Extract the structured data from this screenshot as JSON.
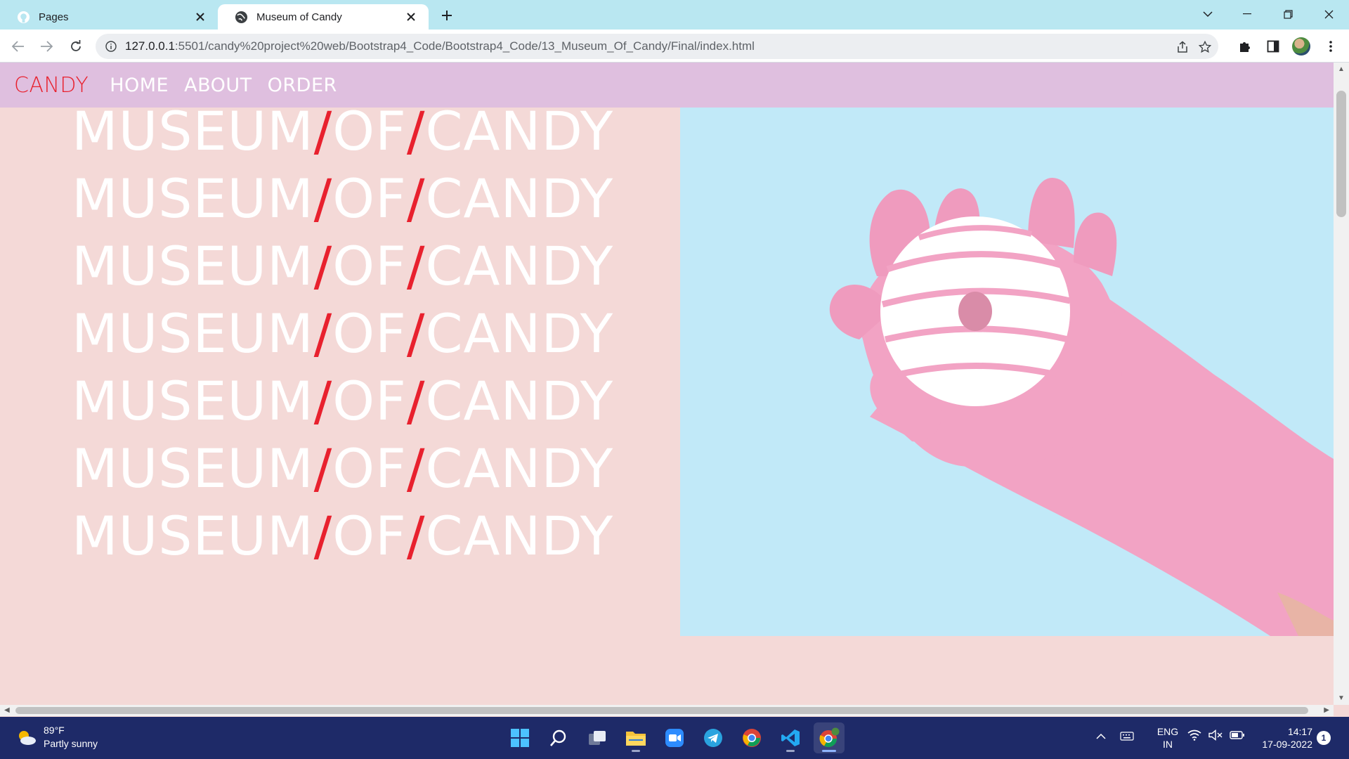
{
  "browser": {
    "tabs": [
      {
        "title": "Pages",
        "icon": "github-icon",
        "active": false
      },
      {
        "title": "Museum of Candy",
        "icon": "globe-icon",
        "active": true
      }
    ],
    "address": {
      "host": "127.0.0.1",
      "rest": ":5501/candy%20project%20web/Bootstrap4_Code/Bootstrap4_Code/13_Museum_Of_Candy/Final/index.html"
    }
  },
  "site": {
    "brand": "CANDY",
    "nav": [
      "HOME",
      "ABOUT",
      "ORDER"
    ],
    "headline": {
      "word1": "MUSEUM",
      "separator": "/",
      "word2": "OF",
      "word3": "CANDY",
      "repeat": 7
    }
  },
  "taskbar": {
    "weather": {
      "temp": "89°F",
      "condition": "Partly sunny"
    },
    "language": {
      "line1": "ENG",
      "line2": "IN"
    },
    "clock": {
      "time": "14:17",
      "date": "17-09-2022"
    },
    "notifications": "1"
  },
  "colors": {
    "accent_red": "#e8212e",
    "page_bg": "#f4d9d7",
    "nav_bg": "#dfbfdf",
    "hero_bg": "#c1e9f8",
    "glove_pink": "#f2a3c4",
    "tabbar_bg": "#b9e7f1",
    "taskbar_bg": "#1e2a68"
  }
}
